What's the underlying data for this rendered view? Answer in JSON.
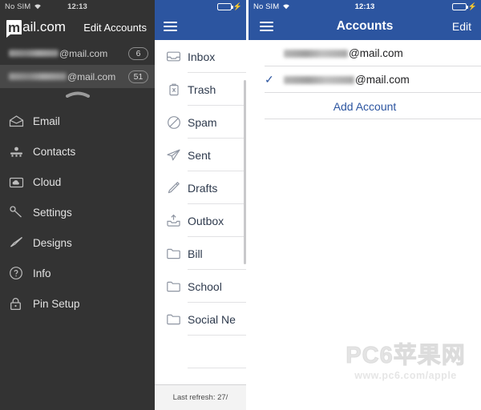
{
  "status_bar": {
    "carrier": "No SIM",
    "time": "12:13",
    "wifi_icon": "wifi-icon",
    "battery_icon": "battery-charging-icon"
  },
  "drawer": {
    "logo_m": "m",
    "logo_rest": "ail.com",
    "edit_accounts_label": "Edit Accounts",
    "accounts": [
      {
        "name_masked": "",
        "domain": "@mail.com",
        "badge": "6",
        "selected": false
      },
      {
        "name_masked": "",
        "domain": "@mail.com",
        "badge": "51",
        "selected": true
      }
    ],
    "handle_icon": "collapse-handle-icon",
    "items": [
      {
        "label": "Email",
        "icon": "envelope-open-icon"
      },
      {
        "label": "Contacts",
        "icon": "contacts-icon"
      },
      {
        "label": "Cloud",
        "icon": "cloud-folder-icon"
      },
      {
        "label": "Settings",
        "icon": "wrench-icon"
      },
      {
        "label": "Designs",
        "icon": "paintbrush-icon"
      },
      {
        "label": "Info",
        "icon": "question-circle-icon"
      },
      {
        "label": "Pin Setup",
        "icon": "lock-icon"
      }
    ]
  },
  "folders_panel": {
    "menu_icon": "hamburger-icon",
    "folders": [
      {
        "label": "Inbox",
        "icon": "inbox-icon"
      },
      {
        "label": "Trash",
        "icon": "trash-icon"
      },
      {
        "label": "Spam",
        "icon": "no-entry-icon"
      },
      {
        "label": "Sent",
        "icon": "paper-plane-icon"
      },
      {
        "label": "Drafts",
        "icon": "pencil-icon"
      },
      {
        "label": "Outbox",
        "icon": "outbox-icon"
      },
      {
        "label": "Bill",
        "icon": "folder-icon"
      },
      {
        "label": "School",
        "icon": "folder-icon"
      },
      {
        "label": "Social Ne",
        "icon": "folder-icon"
      }
    ],
    "footer_text": "Last refresh: 27/"
  },
  "accounts_panel": {
    "menu_icon": "hamburger-icon",
    "title": "Accounts",
    "edit_label": "Edit",
    "rows": [
      {
        "name_masked": "",
        "domain": "@mail.com",
        "checked": false,
        "check_icon": ""
      },
      {
        "name_masked": "",
        "domain": "@mail.com",
        "checked": true,
        "check_icon": "✓"
      }
    ],
    "add_account_label": "Add Account"
  },
  "watermark": {
    "main": "PC6苹果网",
    "sub": "www.pc6.com/apple"
  },
  "colors": {
    "nav_blue": "#2c55a0",
    "drawer_bg": "#333333",
    "drawer_selected": "#484848",
    "battery_green": "#4cd964",
    "link_blue": "#2c55a0"
  }
}
